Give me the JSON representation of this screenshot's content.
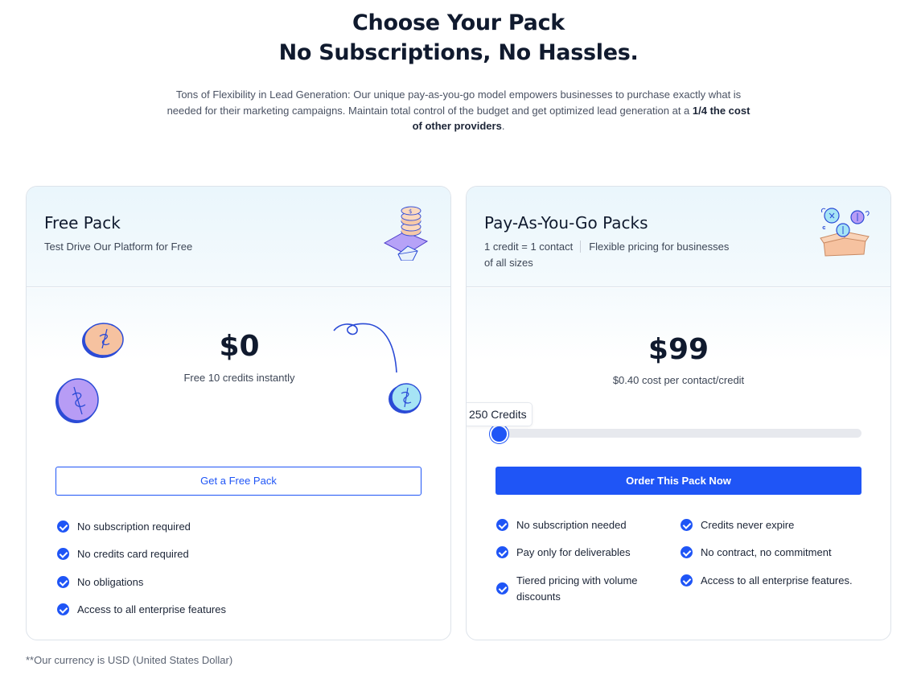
{
  "hero": {
    "title_line1": "Choose Your Pack",
    "title_line2": "No Subscriptions, No Hassles.",
    "desc_main": "Tons of Flexibility in Lead Generation: Our unique pay-as-you-go model empowers businesses to purchase exactly what is needed for their marketing campaigns. Maintain total control of the budget and get optimized lead generation at a ",
    "desc_bold": "1/4 the cost of other providers",
    "desc_end": "."
  },
  "free_pack": {
    "title": "Free Pack",
    "subtitle": "Test Drive Our Platform for Free",
    "price": "$0",
    "price_note": "Free 10 credits instantly",
    "button_label": "Get a Free Pack",
    "features": [
      "No subscription required",
      "No credits card required",
      "No obligations",
      "Access to all enterprise features"
    ]
  },
  "paygo_pack": {
    "title": "Pay-As-You-Go Packs",
    "subtitle_part1": "1 credit = 1 contact",
    "subtitle_part2": "Flexible pricing for businesses",
    "subtitle_part3": "of all sizes",
    "price": "$99",
    "price_note_amount": "$0.40",
    "price_note_text": "cost per contact/credit",
    "slider_label": "250 Credits",
    "slider_position": 0.0,
    "button_label": "Order This Pack Now",
    "features_left": [
      "No subscription needed",
      "Pay only for deliverables",
      "Tiered pricing with volume discounts"
    ],
    "features_right": [
      "Credits never expire",
      "No contract, no commitment",
      "Access to all enterprise features."
    ]
  },
  "footnote": "**Our currency is USD (United States Dollar)",
  "colors": {
    "accent": "#1f55f6",
    "heading": "#101a2e",
    "header_bg": "#eaf6fc"
  }
}
